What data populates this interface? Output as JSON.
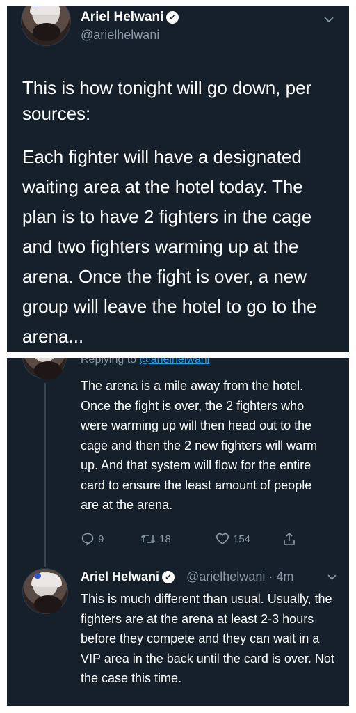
{
  "tweet1": {
    "author_name": "Ariel Helwani",
    "handle": "@arielhelwani",
    "intro": "This is how tonight will go down, per sources:",
    "body": "Each fighter will have a designated waiting area at the hotel today. The plan is to have 2 fighters in the cage and two fighters warming up at the arena. Once the fight is over, a new group will leave the hotel to go to the arena..."
  },
  "tweet2": {
    "replying_prefix": "Replying to",
    "replying_handle": "@arielhelwani",
    "body": "The arena is a mile away from the hotel. Once the fight is over, the 2 fighters who were warming up will then head out to the cage and then the 2 new fighters will warm up. And that system will flow for the entire card to ensure the least amount of people are at the arena.",
    "replies": "9",
    "retweets": "18",
    "likes": "154"
  },
  "tweet3": {
    "author_name": "Ariel Helwani",
    "handle_time": "@arielhelwani · 4m",
    "body": "This is much different than usual. Usually, the fighters are at the arena at least 2-3 hours before they compete and they can wait in a VIP area in the back until the card is over. Not the case this time."
  },
  "icons": {
    "verified": "verified-badge-icon",
    "chevron": "chevron-down-icon",
    "reply": "reply-icon",
    "retweet": "retweet-icon",
    "like": "heart-icon",
    "share": "share-icon"
  },
  "colors": {
    "background": "#15202b",
    "text": "#ffffff",
    "secondary": "#8899a6",
    "link": "#1da1f2"
  }
}
